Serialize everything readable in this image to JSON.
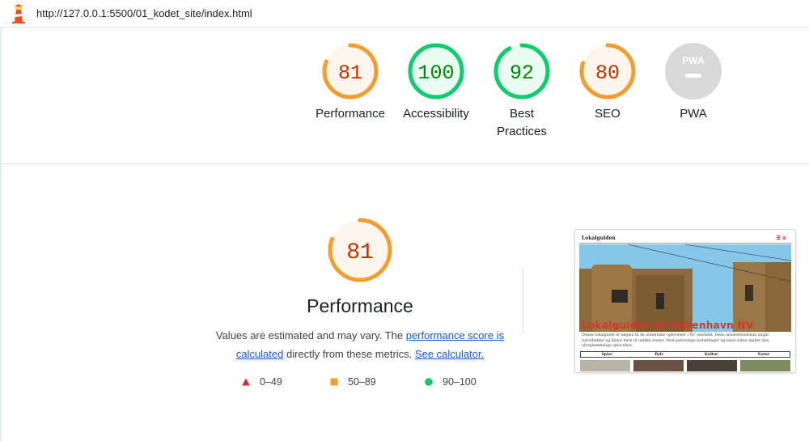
{
  "address_bar": {
    "url": "http://127.0.0.1:5500/01_kodet_site/index.html"
  },
  "colors": {
    "fail": "#e5262b",
    "average": "#f29d2c",
    "pass": "#0cce6b",
    "na": "#d6d6d6"
  },
  "scores": [
    {
      "value": "81",
      "label": "Performance",
      "status": "average",
      "fraction": 0.81
    },
    {
      "value": "100",
      "label": "Accessibility",
      "status": "pass",
      "fraction": 1.0
    },
    {
      "value": "92",
      "label": "Best Practices",
      "status": "pass",
      "fraction": 0.92
    },
    {
      "value": "80",
      "label": "SEO",
      "status": "average",
      "fraction": 0.8
    },
    {
      "value": "PWA",
      "label": "PWA",
      "status": "na",
      "fraction": 0
    }
  ],
  "performance": {
    "score": "81",
    "fraction": 0.81,
    "title": "Performance",
    "desc_text1": "Values are estimated and may vary. The ",
    "desc_link1": "performance score is calculated",
    "desc_text2": " directly from these metrics. ",
    "desc_link2": "See calculator."
  },
  "legend": [
    {
      "range": "0–49",
      "shape": "triangle",
      "status": "fail"
    },
    {
      "range": "50–89",
      "shape": "square",
      "status": "average"
    },
    {
      "range": "90–100",
      "shape": "circle",
      "status": "pass"
    }
  ],
  "screenshot": {
    "site_title": "Lokalguiden",
    "hero_title": "Lokalguiden til København NV",
    "intro": "Denne lokalguide er nøglen til de autentiske oplevelser i NV området. Dens insiderkendskab udgår turistfælder og åbner døre til unikke steder. Med personlige fortællinger og lokal viden skaber den uforglemmelige oplevelser.",
    "table_headers": [
      "Spise",
      "Bylv",
      "Kultur",
      "Natur"
    ]
  }
}
